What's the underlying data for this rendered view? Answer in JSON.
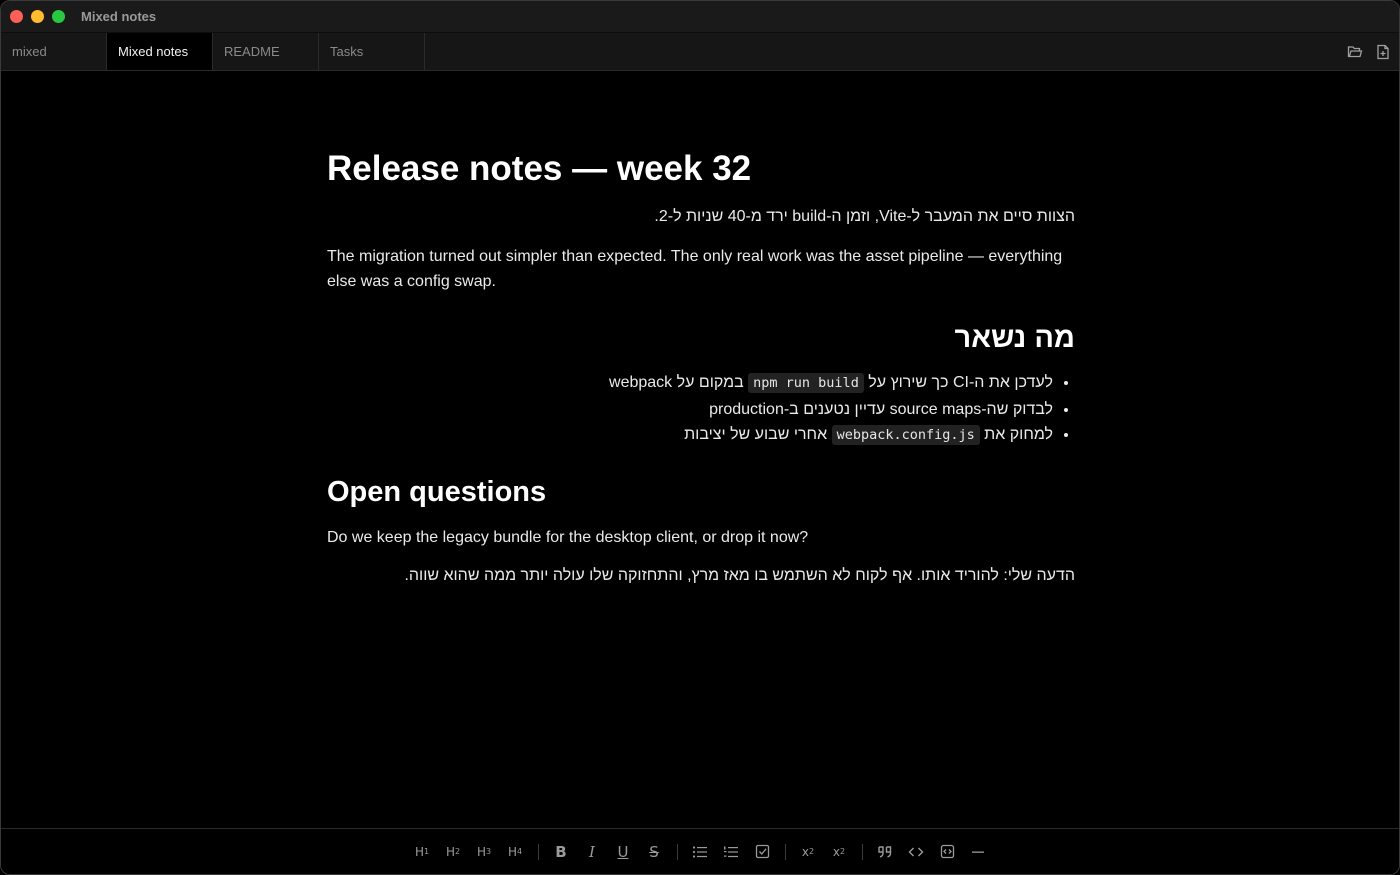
{
  "window": {
    "title": "Mixed notes"
  },
  "tabs": [
    {
      "label": "mixed",
      "active": false
    },
    {
      "label": "Mixed notes",
      "active": true
    },
    {
      "label": "README",
      "active": false
    },
    {
      "label": "Tasks",
      "active": false
    }
  ],
  "tab_actions": {
    "open_icon": "folder-open-icon",
    "new_icon": "new-file-icon"
  },
  "document": {
    "title": "Release notes — week 32",
    "intro_rtl": "הצוות סיים את המעבר ל-Vite, וזמן ה-build ירד מ-40 שניות ל-2.",
    "intro_en": "The migration turned out simpler than expected. The only real work was the asset pipeline — everything else was a config swap.",
    "section_rtl_heading": "מה נשאר",
    "list": [
      {
        "before": "לעדכן את ה-CI כך שירוץ על ",
        "code": "npm run build",
        "after": " במקום על webpack"
      },
      {
        "before": "לבדוק שה-source maps עדיין נטענים ב-production",
        "code": "",
        "after": ""
      },
      {
        "before": "למחוק את ",
        "code": "webpack.config.js",
        "after": " אחרי שבוע של יציבות"
      }
    ],
    "section_en_heading": "Open questions",
    "question": "Do we keep the legacy bundle for the desktop client, or drop it now?",
    "opinion_rtl": "הדעה שלי: להוריד אותו. אף לקוח לא השתמש בו מאז מרץ, והתחזוקה שלו עולה יותר ממה שהוא שווה."
  },
  "toolbar": {
    "h1": "H",
    "h2": "H",
    "h3": "H",
    "h4": "H",
    "h1_sub": "1",
    "h2_sub": "2",
    "h3_sub": "3",
    "h4_sub": "4",
    "bold": "B",
    "italic": "I",
    "underline": "U",
    "strike": "S",
    "subscript": "x",
    "subscript_mark": "2",
    "superscript": "x",
    "superscript_mark": "2"
  },
  "colors": {
    "accent_red": "#fe5f57",
    "accent_yellow": "#febc2e",
    "accent_green": "#28c840",
    "background": "#000000"
  }
}
